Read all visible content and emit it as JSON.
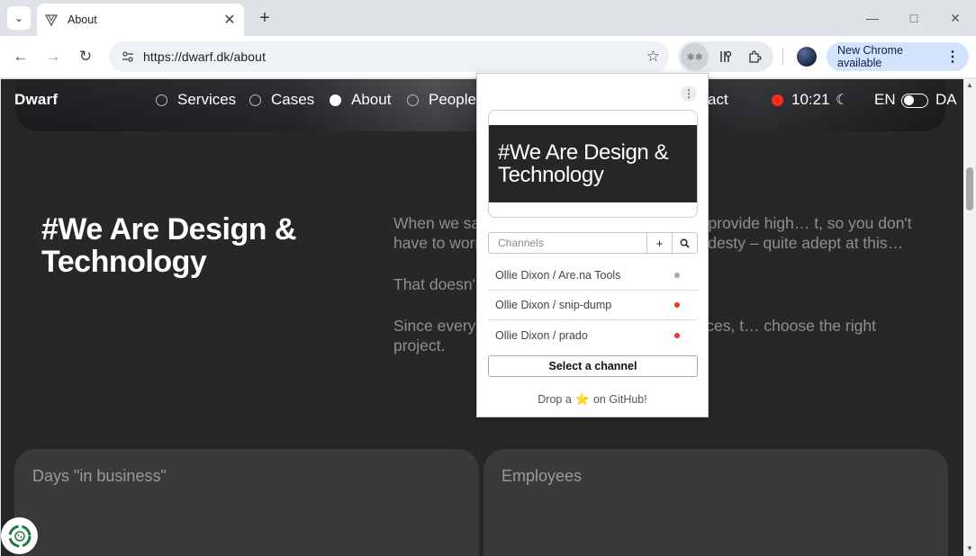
{
  "browser": {
    "tab": {
      "title": "About",
      "favicon": "triangle-logo-icon"
    },
    "url": "https://dwarf.dk/about",
    "update_button": "New Chrome available"
  },
  "site": {
    "brand": "Dwarf",
    "nav": [
      {
        "label": "Services",
        "selected": false
      },
      {
        "label": "Cases",
        "selected": false
      },
      {
        "label": "About",
        "selected": true
      },
      {
        "label": "People",
        "selected": false
      }
    ],
    "contact_fragment": "act",
    "clock": "10:21",
    "lang_en": "EN",
    "lang_da": "DA",
    "headline": "#We Are Design & Technology",
    "body": {
      "p1": "When we sa… bout taking responsibility. We provide high… t, so you don't have to worry about that p… e are – in all modesty – quite adept at this…",
      "p2": "That doesn'…",
      "p3": "Since every… possibilities and limited resources, t… choose the right project."
    },
    "stats": {
      "days_label": "Days \"in business\"",
      "employees_label": "Employees"
    }
  },
  "popup": {
    "preview_text": "#We Are Design & Technology",
    "search_placeholder": "Channels",
    "add_label": "+",
    "channels": [
      {
        "name": "Ollie Dixon / Are.na Tools",
        "dot_color": "#a8a8a8"
      },
      {
        "name": "Ollie Dixon / snip-dump",
        "dot_color": "#e53935"
      },
      {
        "name": "Ollie Dixon / prado",
        "dot_color": "#e53935"
      }
    ],
    "select_button": "Select a channel",
    "footer_before": "Drop a",
    "footer_after": "on GitHub!"
  },
  "colors": {
    "page_bg": "#272727",
    "card_bg": "#3a3a3a",
    "record_dot": "#ff2a1a",
    "update_button_bg": "#d3e3fd"
  }
}
